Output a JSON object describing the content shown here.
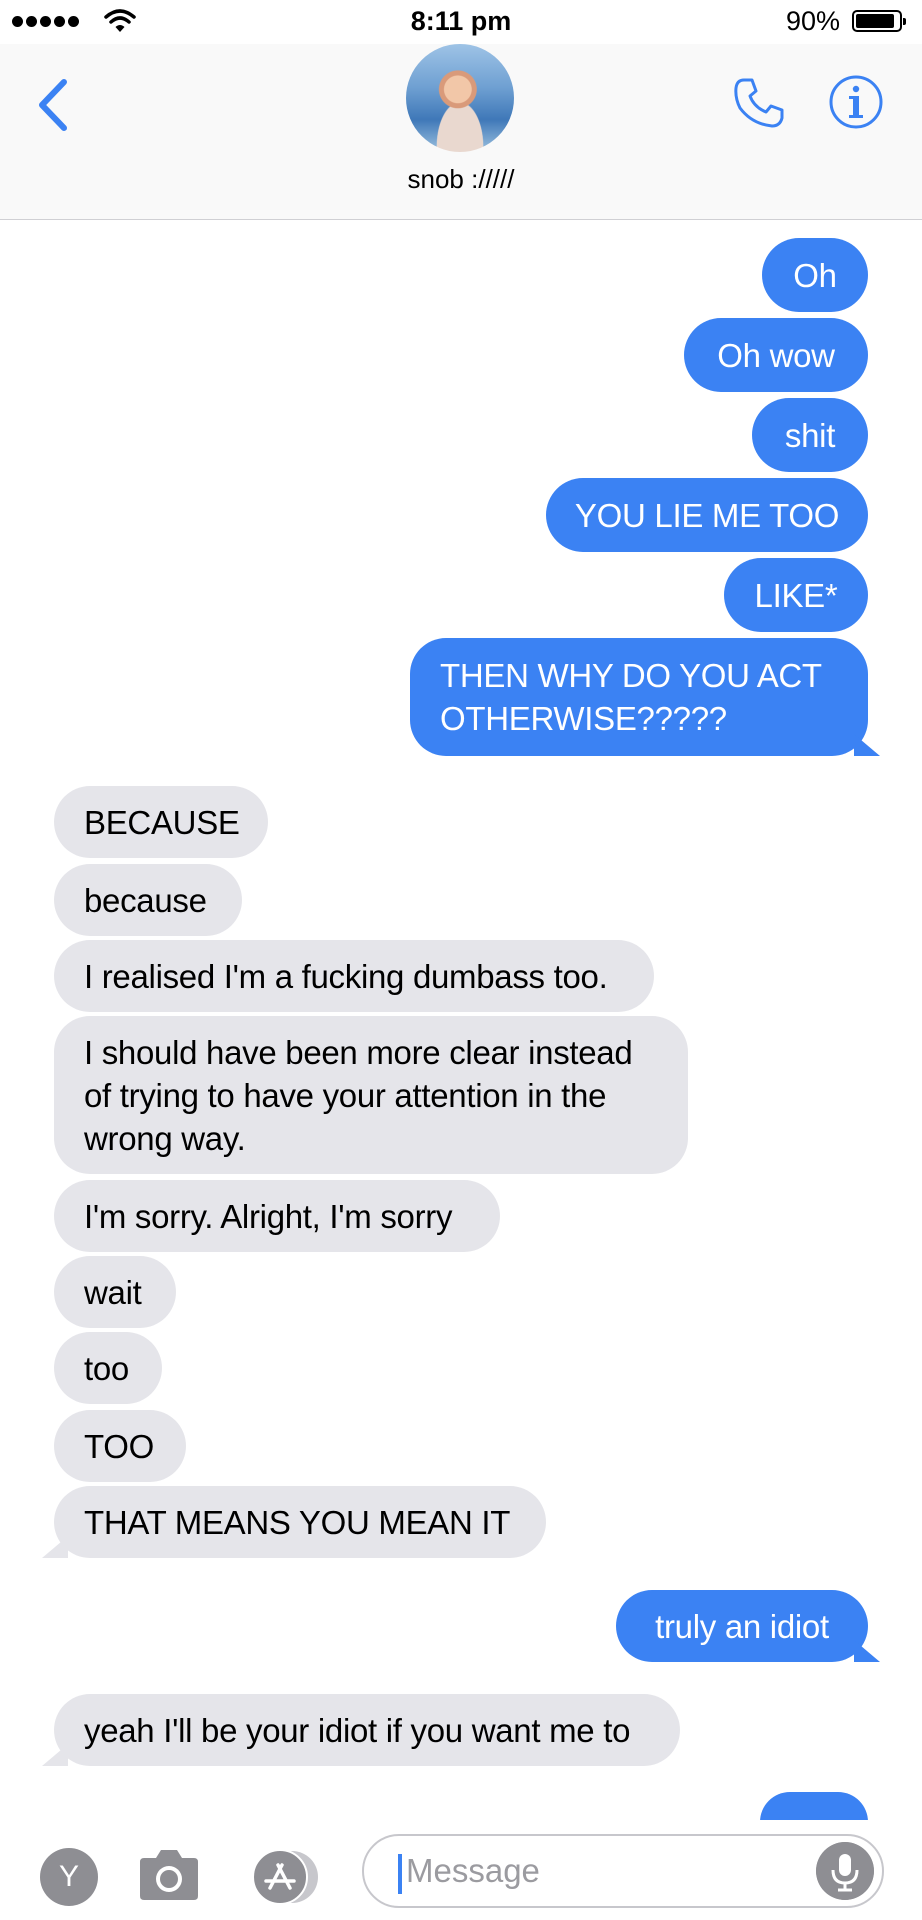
{
  "status_bar": {
    "time": "8:11 pm",
    "battery_percent_text": "90%",
    "battery_level": 0.9,
    "signal_icon": "signal-dots-icon",
    "wifi_icon": "wifi-icon"
  },
  "header": {
    "contact_name": "snob ://///"
  },
  "messages": [
    {
      "side": "sent",
      "text": "Oh"
    },
    {
      "side": "sent",
      "text": "Oh wow"
    },
    {
      "side": "sent",
      "text": "shit"
    },
    {
      "side": "sent",
      "text": "YOU LIE ME TOO"
    },
    {
      "side": "sent",
      "text": "LIKE*"
    },
    {
      "side": "sent",
      "text": "THEN WHY DO YOU ACT OTHERWISE?????"
    },
    {
      "side": "received",
      "text": "BECAUSE"
    },
    {
      "side": "received",
      "text": "because"
    },
    {
      "side": "received",
      "text": "I realised I'm a fucking dumbass too."
    },
    {
      "side": "received",
      "text": "I should have been more clear instead of trying to have your attention in the wrong way."
    },
    {
      "side": "received",
      "text": "I'm sorry. Alright, I'm sorry"
    },
    {
      "side": "received",
      "text": "wait"
    },
    {
      "side": "received",
      "text": "too"
    },
    {
      "side": "received",
      "text": "TOO"
    },
    {
      "side": "received",
      "text": "THAT MEANS YOU MEAN IT"
    },
    {
      "side": "sent",
      "text": "truly an idiot"
    },
    {
      "side": "received",
      "text": "yeah I'll be your idiot if you want me to"
    }
  ],
  "composer": {
    "app_button_label": "Y",
    "placeholder": "Message"
  },
  "colors": {
    "sent_bubble": "#3b82f3",
    "received_bubble": "#e5e5ea",
    "accent": "#3b82f3"
  }
}
